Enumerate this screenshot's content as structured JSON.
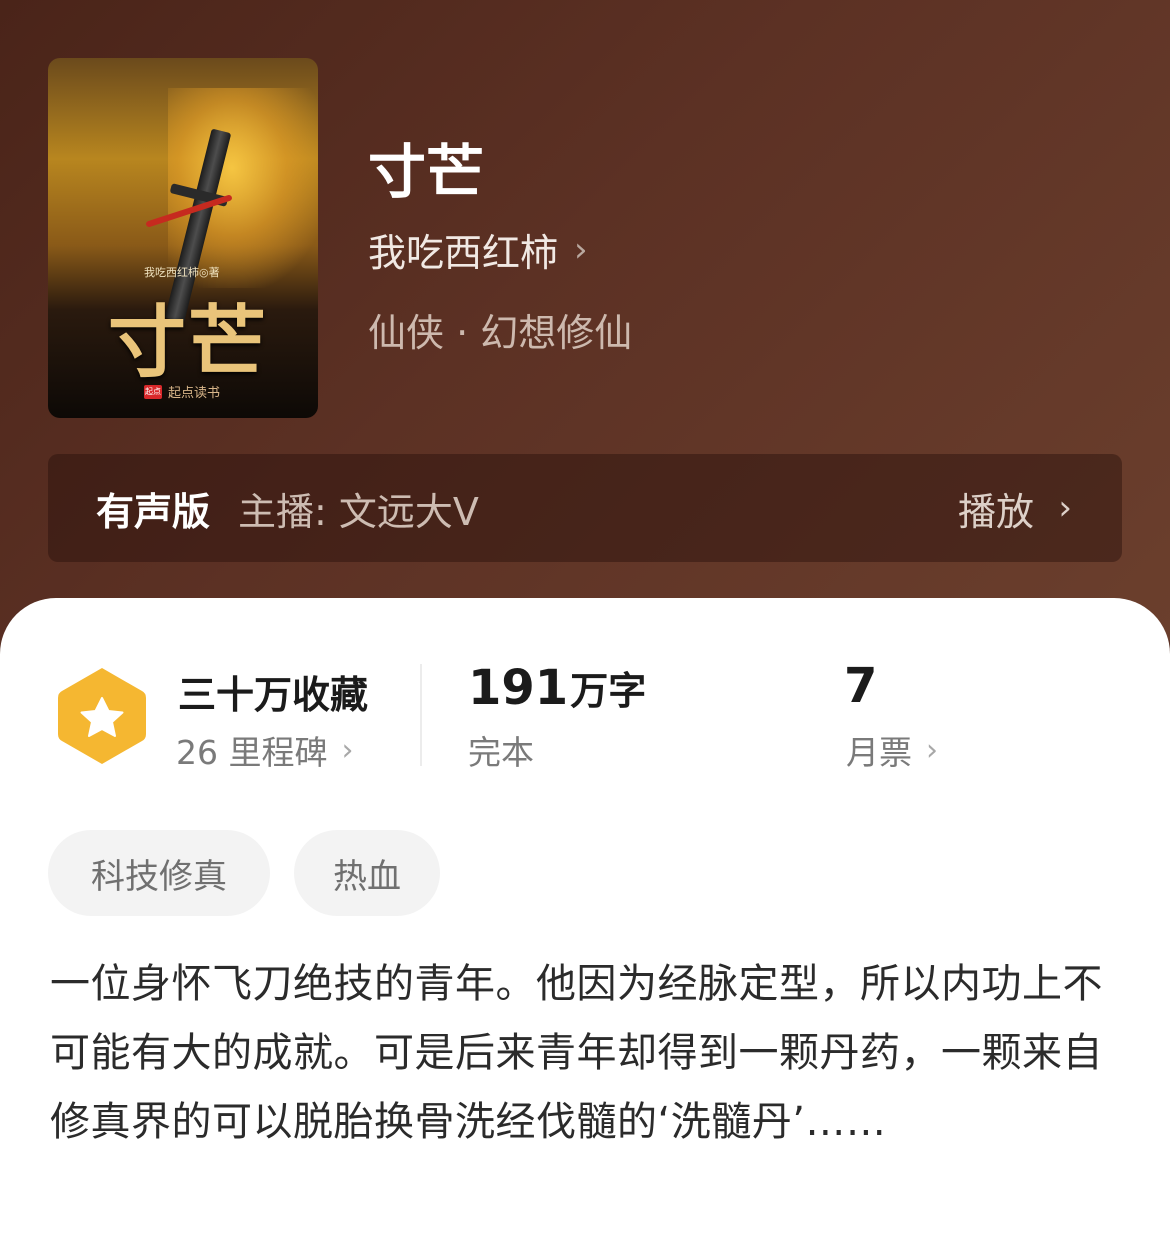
{
  "cover": {
    "author_line": "我吃西红柿◎著",
    "title": "寸芒",
    "publisher_badge": "起点",
    "publisher": "起点读书"
  },
  "book": {
    "title": "寸芒",
    "author": "我吃西红柿",
    "genre": "仙侠 · 幻想修仙"
  },
  "audio": {
    "label": "有声版",
    "host": "主播: 文远大V",
    "play": "播放"
  },
  "stats": {
    "collections": "三十万收藏",
    "milestones": "26 里程碑",
    "word_count": "191",
    "word_unit": "万字",
    "status": "完本",
    "monthly_votes": "7",
    "monthly_votes_label": "月票"
  },
  "tags": [
    "科技修真",
    "热血"
  ],
  "description": "一位身怀飞刀绝技的青年。他因为经脉定型，所以内功上不可能有大的成就。可是后来青年却得到一颗丹药，一颗来自修真界的可以脱胎换骨洗经伐髓的‘洗髓丹’……",
  "colors": {
    "hero_bg": "#5c3124",
    "badge": "#f5b731",
    "card_bg": "#ffffff"
  },
  "icons": {
    "author_chevron": "chevron-right-icon",
    "badge": "star-hexagon-icon"
  }
}
